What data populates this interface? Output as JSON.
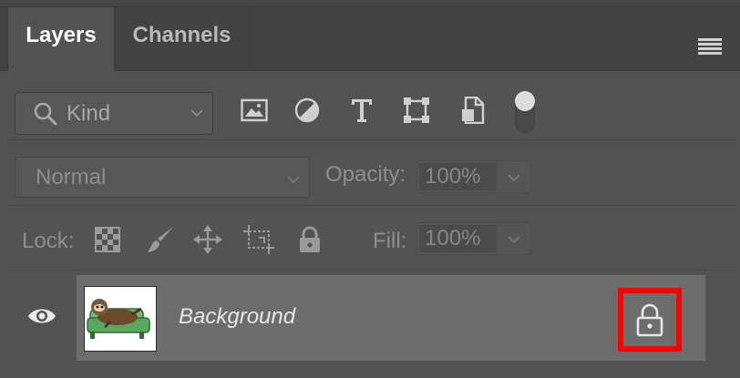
{
  "tabs": [
    {
      "label": "Layers",
      "active": true
    },
    {
      "label": "Channels",
      "active": false
    }
  ],
  "filter": {
    "kind_label": "Kind",
    "icons": [
      "image-filter-icon",
      "adjustment-filter-icon",
      "type-filter-icon",
      "shape-filter-icon",
      "smart-object-filter-icon",
      "filter-toggle"
    ]
  },
  "blend": {
    "mode": "Normal",
    "opacity_label": "Opacity:",
    "opacity_value": "100%"
  },
  "lock": {
    "label": "Lock:",
    "icons": [
      "lock-transparent-pixels-icon",
      "lock-image-pixels-icon",
      "lock-position-icon",
      "lock-artboard-icon",
      "lock-all-icon"
    ],
    "fill_label": "Fill:",
    "fill_value": "100%"
  },
  "layers": [
    {
      "name": "Background",
      "visible": true,
      "locked": true
    }
  ],
  "colors": {
    "panel_bg": "#535353",
    "selected_layer_bg": "#6d6d6d",
    "highlight": "#ff0000"
  }
}
